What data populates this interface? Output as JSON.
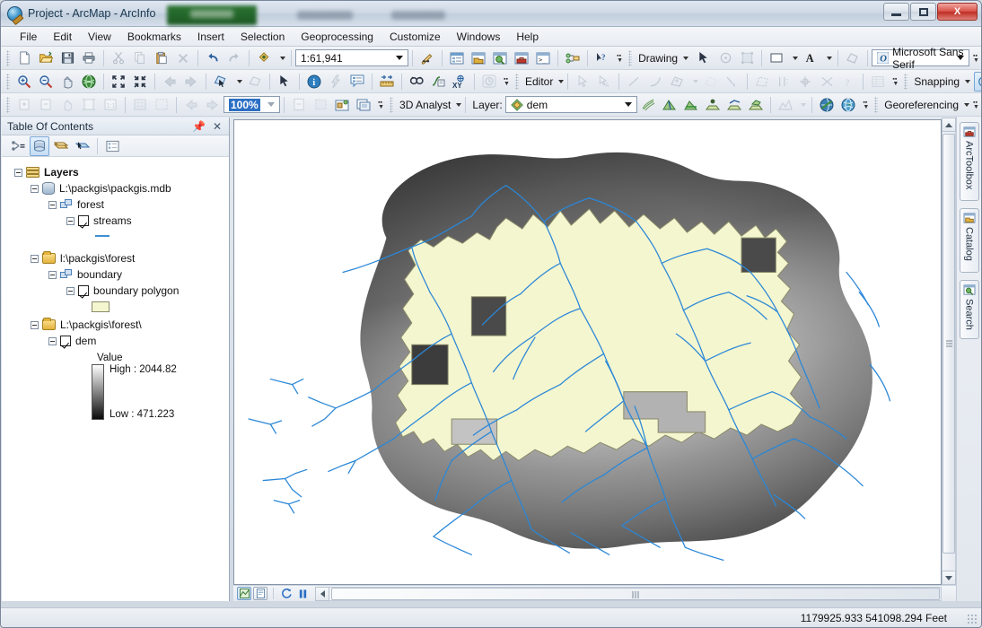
{
  "window": {
    "title": "Project - ArcMap - ArcInfo",
    "app_icon": "arcmap-globe-icon",
    "minimize_label": "Minimize",
    "maximize_label": "Maximize",
    "close_label": "X"
  },
  "menubar": {
    "items": [
      "File",
      "Edit",
      "View",
      "Bookmarks",
      "Insert",
      "Selection",
      "Geoprocessing",
      "Customize",
      "Windows",
      "Help"
    ]
  },
  "standard_toolbar": {
    "scale_value": "1:61,941",
    "icons": [
      "new-document-icon",
      "open-folder-icon",
      "save-icon",
      "print-icon",
      "cut-icon",
      "copy-icon",
      "paste-icon",
      "delete-icon",
      "undo-icon",
      "redo-icon",
      "add-data-icon"
    ],
    "after_scale_icons": [
      "editor-toolbar-icon",
      "table-of-contents-icon",
      "catalog-icon",
      "search-icon",
      "arctoolbox-icon",
      "python-window-icon",
      "model-builder-icon",
      "whats-this-icon"
    ]
  },
  "drawing_toolbar": {
    "label": "Drawing",
    "icons": [
      "select-elements-icon",
      "rotate-icon",
      "select-graphics-icon",
      "fill-color-icon",
      "font-color-icon"
    ],
    "font_name": "Microsoft Sans Serif"
  },
  "tools_toolbar": {
    "icons": [
      "zoom-in-icon",
      "zoom-out-icon",
      "pan-icon",
      "full-extent-icon",
      "fixed-zoom-in-icon",
      "fixed-zoom-out-icon",
      "go-back-icon",
      "go-forward-icon",
      "select-features-icon",
      "clear-selection-icon",
      "select-elements-icon",
      "identify-icon",
      "hyperlink-icon",
      "html-popup-icon",
      "measure-icon",
      "find-icon",
      "find-route-icon",
      "go-to-xy-icon",
      "time-slider-icon"
    ]
  },
  "editor_toolbar": {
    "label": "Editor",
    "icons": [
      "edit-tool-icon",
      "edit-annotation-icon",
      "straight-segment-icon",
      "end-point-arc-icon",
      "trace-icon",
      "modify-feature-icon",
      "reshape-feature-icon",
      "cut-polygons-icon",
      "split-icon",
      "rotate-icon",
      "merge-icon",
      "attributes-icon"
    ]
  },
  "snapping_toolbar": {
    "label": "Snapping",
    "icons": [
      "point-snapping-icon",
      "grid-snapping-icon"
    ]
  },
  "layout_toolbar": {
    "zoom_value": "100%",
    "icons": [
      "zoom-in-layout-icon",
      "zoom-out-layout-icon",
      "pan-layout-icon",
      "zoom-whole-page-icon",
      "zoom-100-icon",
      "fixed-zoom-in-layout-icon",
      "fixed-zoom-out-layout-icon",
      "go-back-layout-icon",
      "go-forward-layout-icon",
      "toggle-draft-mode-icon",
      "focus-data-frame-icon",
      "change-layout-icon",
      "data-driven-pages-icon"
    ]
  },
  "analyst_toolbar": {
    "label": "3D Analyst",
    "layer_label": "Layer:",
    "layer_value": "dem",
    "layer_icon": "raster-layer-icon",
    "icons": [
      "contour-icon",
      "steepest-path-icon",
      "line-of-sight-icon",
      "interpolate-point-icon",
      "interpolate-line-icon",
      "interpolate-polygon-icon",
      "profile-graph-icon",
      "arcscene-icon",
      "arcglobe-icon"
    ]
  },
  "georeferencing_toolbar": {
    "label": "Georeferencing"
  },
  "toc": {
    "title": "Table Of Contents",
    "pin_icon": "pin-icon",
    "close_icon": "close-icon",
    "tool_icons": [
      "list-by-drawing-order-icon",
      "list-by-source-icon",
      "list-by-visibility-icon",
      "list-by-selection-icon",
      "options-icon"
    ],
    "tree": [
      {
        "label": "Layers",
        "icon": "layers-icon",
        "depth": 0,
        "bold": true,
        "expander": true
      },
      {
        "label": "L:\\packgis\\packgis.mdb",
        "icon": "geodatabase-icon",
        "depth": 1,
        "expander": true
      },
      {
        "label": "forest",
        "icon": "feature-dataset-icon",
        "depth": 2,
        "expander": true
      },
      {
        "label": "streams",
        "icon": "checkbox",
        "depth": 3,
        "expander": true,
        "checked": true
      },
      {
        "label": "",
        "icon": "stream-line-symbol",
        "depth": 4
      },
      {
        "label": "l:\\packgis\\forest",
        "icon": "folder-icon",
        "depth": 1,
        "expander": true
      },
      {
        "label": "boundary",
        "icon": "feature-dataset-icon",
        "depth": 2,
        "expander": true
      },
      {
        "label": "boundary polygon",
        "icon": "checkbox",
        "depth": 3,
        "expander": true,
        "checked": true
      },
      {
        "label": "",
        "icon": "polygon-fill-symbol",
        "depth": 4
      },
      {
        "label": "L:\\packgis\\forest\\",
        "icon": "folder-icon",
        "depth": 1,
        "expander": true
      },
      {
        "label": "dem",
        "icon": "checkbox",
        "depth": 2,
        "expander": true,
        "checked": true
      }
    ],
    "legend": {
      "value_label": "Value",
      "high_label": "High : 2044.82",
      "low_label": "Low : 471.223",
      "ramp_high_color": "#ffffff",
      "ramp_low_color": "#000000"
    }
  },
  "map": {
    "bottom_buttons": [
      "data-view-icon",
      "layout-view-icon",
      "refresh-icon",
      "pause-drawing-icon"
    ],
    "colors": {
      "boundary_fill": "#f4f6cf",
      "boundary_outline": "#8a8a6a",
      "stream_line": "#2a87d8",
      "dem_high": "#f2f2f2",
      "dem_low": "#1c1c1c",
      "background": "#ffffff"
    }
  },
  "right_dock": {
    "tabs": [
      {
        "label": "ArcToolbox",
        "icon": "arctoolbox-icon"
      },
      {
        "label": "Catalog",
        "icon": "catalog-icon"
      },
      {
        "label": "Search",
        "icon": "search-icon"
      }
    ]
  },
  "statusbar": {
    "coordinates": "1179925.933  541098.294 Feet"
  }
}
